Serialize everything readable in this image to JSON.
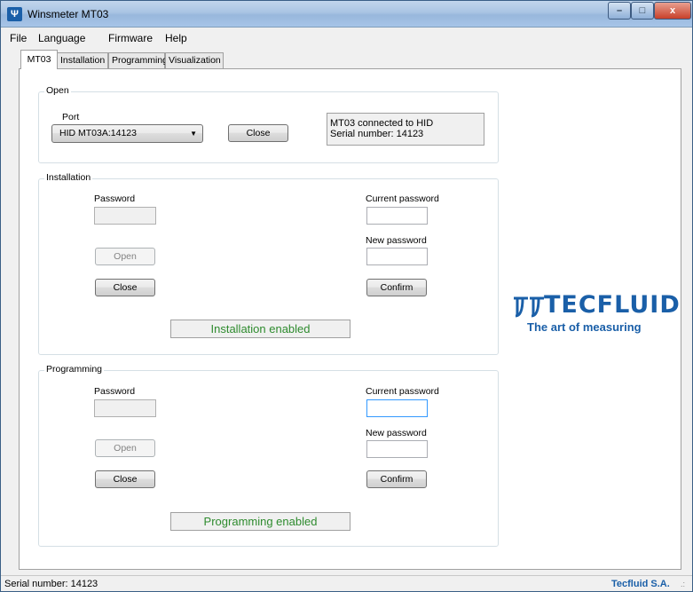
{
  "window": {
    "title": "Winsmeter MT03",
    "icon": "tecfluid-app-icon",
    "controls": {
      "minimize": "–",
      "maximize": "□",
      "close": "x"
    }
  },
  "menu": [
    "File",
    "Language",
    "Firmware",
    "Help"
  ],
  "tabs": [
    {
      "label": "MT03",
      "active": true
    },
    {
      "label": "Installation",
      "active": false
    },
    {
      "label": "Programming",
      "active": false
    },
    {
      "label": "Visualization",
      "active": false
    }
  ],
  "open_group": {
    "title": "Open",
    "port_label": "Port",
    "port_value": "HID  MT03A:14123",
    "close_button": "Close",
    "status_line1": "MT03 connected to HID",
    "status_line2": "Serial number: 14123"
  },
  "installation_group": {
    "title": "Installation",
    "password_label": "Password",
    "open_button": "Open",
    "close_button": "Close",
    "current_password_label": "Current password",
    "new_password_label": "New password",
    "confirm_button": "Confirm",
    "status": "Installation enabled"
  },
  "programming_group": {
    "title": "Programming",
    "password_label": "Password",
    "open_button": "Open",
    "close_button": "Close",
    "current_password_label": "Current password",
    "new_password_label": "New password",
    "confirm_button": "Confirm",
    "status": "Programming enabled"
  },
  "logo": {
    "wordmark": "TECFLUID",
    "tagline": "The art of measuring",
    "color": "#1a5fa8"
  },
  "status_green": "#2e8b2e",
  "statusbar": {
    "left": "Serial number: 14123",
    "right": "Tecfluid S.A."
  }
}
